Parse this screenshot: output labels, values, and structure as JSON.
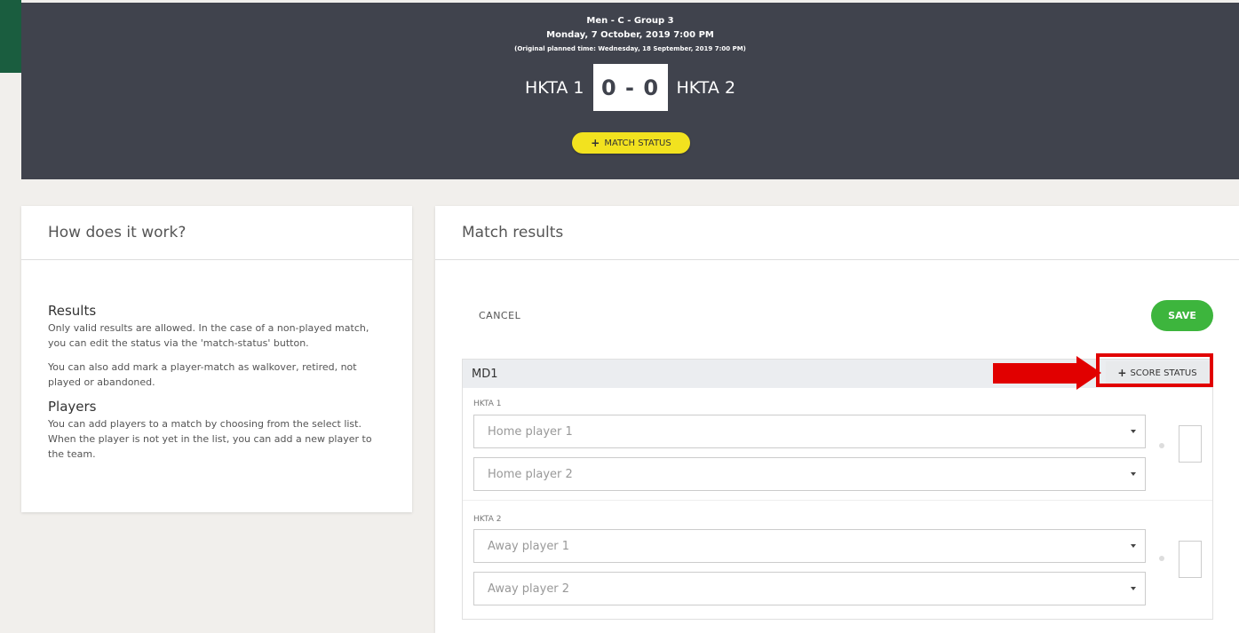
{
  "header": {
    "group": "Men - C - Group 3",
    "datetime": "Monday, 7 October, 2019 7:00 PM",
    "original_time": "(Original planned time: Wednesday, 18 September, 2019 7:00 PM)",
    "home_team": "HKTA 1",
    "score": "0 - 0",
    "away_team": "HKTA 2",
    "match_status_label": "MATCH STATUS"
  },
  "howto": {
    "title": "How does it work?",
    "results_heading": "Results",
    "results_text1": "Only valid results are allowed. In the case of a non-played match, you can edit the status via the 'match-status' button.",
    "results_text2": "You can also add mark a player-match as walkover, retired, not played or abandoned.",
    "players_heading": "Players",
    "players_text": "You can add players to a match by choosing from the select list. When the player is not yet in the list, you can add a new player to the team."
  },
  "results": {
    "title": "Match results",
    "cancel_label": "CANCEL",
    "save_label": "SAVE",
    "match": {
      "name": "MD1",
      "score_status_label": "SCORE STATUS",
      "home_label": "HKTA 1",
      "away_label": "HKTA 2",
      "home_player1": "Home player 1",
      "home_player2": "Home player 2",
      "away_player1": "Away player 1",
      "away_player2": "Away player 2"
    }
  },
  "colors": {
    "header_bg": "#40434d",
    "status_yellow": "#f2e21f",
    "save_green": "#3db53d",
    "highlight_red": "#e10000"
  }
}
